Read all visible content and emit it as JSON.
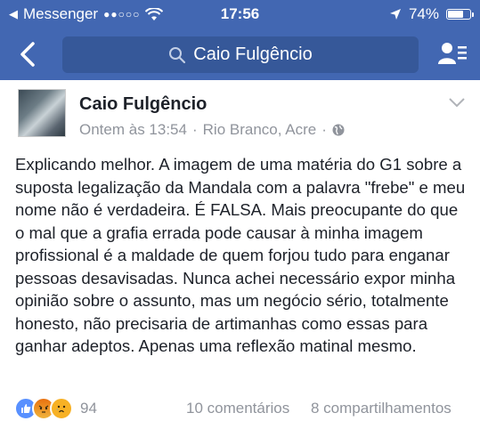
{
  "status_bar": {
    "carrier": "Messenger",
    "signal": "●●○○○",
    "time": "17:56",
    "battery": "74%",
    "battery_level": 0.74
  },
  "nav": {
    "search_text": "Caio Fulgêncio",
    "back_icon": "chevron-left-icon",
    "friends_icon": "friends-list-icon"
  },
  "post": {
    "author": "Caio Fulgêncio",
    "timestamp": "Ontem às 13:54",
    "separator": "·",
    "location": "Rio Branco, Acre",
    "body": "Explicando melhor. A imagem de uma matéria do G1 sobre a suposta legalização da Mandala com a palavra \"frebe\" e meu nome não é verdadeira. É FALSA. Mais preocupante do que o mal que a grafia errada pode causar à minha imagem profissional é a maldade de quem forjou tudo para enganar pessoas desavisadas. Nunca achei necessário expor minha opinião sobre o assunto, mas um negócio sério, totalmente honesto, não precisaria de artimanhas como essas para ganhar adeptos. Apenas uma reflexão matinal mesmo."
  },
  "footer": {
    "reaction_count": "94",
    "comments": "10 comentários",
    "shares": "8 compartilhamentos"
  },
  "colors": {
    "brand": "#4267b2",
    "search_bg": "#365899",
    "text": "#1d2129",
    "muted": "#90949c",
    "like": "#5890ff",
    "angry": "#e9710f",
    "sad": "#f7b125"
  }
}
